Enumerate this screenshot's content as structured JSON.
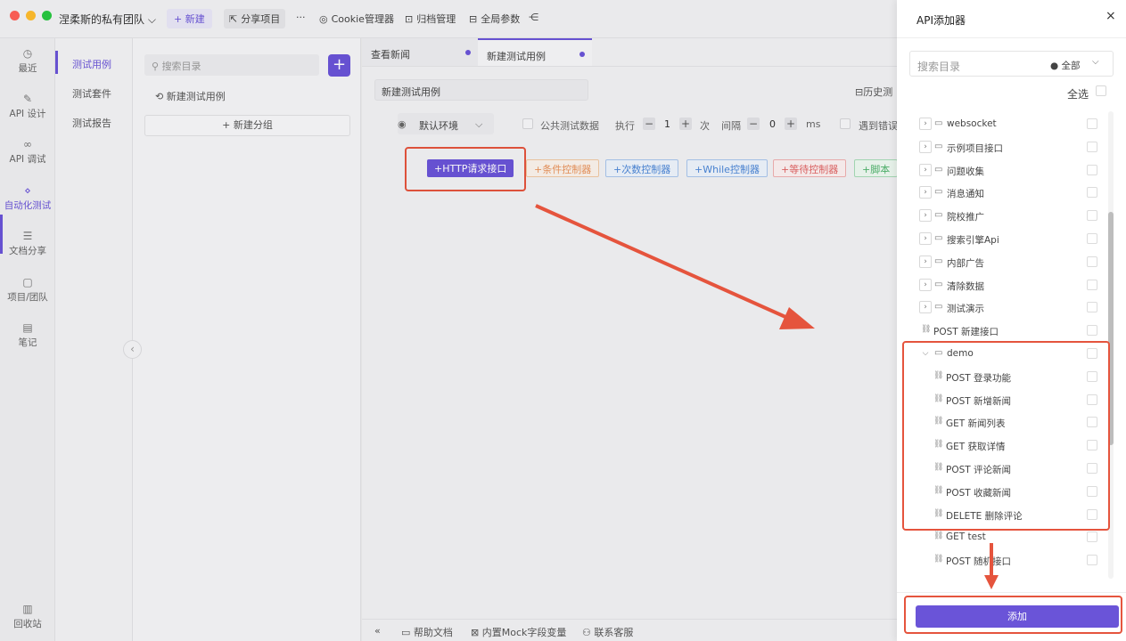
{
  "titlebar": {
    "team": "涅柔斯的私有团队",
    "new_label": "+ 新建",
    "share_label": "分享项目",
    "more": "···",
    "cookie_label": "Cookie管理器",
    "archive_label": "归档管理",
    "params_label": "全局参数"
  },
  "leftnav": {
    "items": [
      {
        "label": "最近",
        "icon": "clock-icon"
      },
      {
        "label": "API 设计",
        "icon": "edit-icon"
      },
      {
        "label": "API 调试",
        "icon": "link-icon"
      },
      {
        "label": "自动化测试",
        "icon": "flow-icon",
        "active": true
      },
      {
        "label": "文档分享",
        "icon": "doc-icon"
      },
      {
        "label": "项目/团队",
        "icon": "box-icon"
      },
      {
        "label": "笔记",
        "icon": "note-icon"
      }
    ],
    "trash": "回收站"
  },
  "subnav": {
    "items": [
      "测试用例",
      "测试套件",
      "测试报告"
    ]
  },
  "treecol": {
    "search_placeholder": "搜索目录",
    "plus": "+",
    "case_label": "新建测试用例",
    "new_group": "+ 新建分组",
    "collapse": "‹"
  },
  "main": {
    "tabs": [
      {
        "label": "查看新闻"
      },
      {
        "label": "新建测试用例"
      }
    ],
    "case_name": "新建测试用例",
    "history": "历史测",
    "config": {
      "env": "默认环境",
      "public_data": "公共测试数据",
      "exec": "执行",
      "exec_count": "1",
      "times_unit": "次",
      "interval": "间隔",
      "interval_value": "0",
      "ms": "ms",
      "on_error": "遇到错误",
      "minus": "−",
      "plus": "+"
    },
    "controls": {
      "http": "+HTTP请求接口",
      "condition": "+条件控制器",
      "count": "+次数控制器",
      "while": "+While控制器",
      "wait": "+等待控制器",
      "script": "+脚本"
    },
    "footer": {
      "collapse": "«",
      "help": "帮助文档",
      "mock": "内置Mock字段变量",
      "support": "联系客服"
    }
  },
  "drawer": {
    "title": "API添加器",
    "close": "×",
    "search_placeholder": "搜索目录",
    "scope": "● 全部",
    "select_all": "全选",
    "tree": [
      {
        "type": "folder",
        "label": "websocket",
        "depth": 0
      },
      {
        "type": "folder",
        "label": "示例项目接口",
        "depth": 0
      },
      {
        "type": "folder",
        "label": "问题收集",
        "depth": 0
      },
      {
        "type": "folder",
        "label": "消息通知",
        "depth": 0
      },
      {
        "type": "folder",
        "label": "院校推广",
        "depth": 0
      },
      {
        "type": "folder",
        "label": "搜索引擎Api",
        "depth": 0
      },
      {
        "type": "folder",
        "label": "内部广告",
        "depth": 0
      },
      {
        "type": "folder",
        "label": "清除数据",
        "depth": 0
      },
      {
        "type": "folder",
        "label": "测试演示",
        "depth": 0
      },
      {
        "type": "api",
        "label": "POST  新建接口",
        "depth": 0
      },
      {
        "type": "folder-open",
        "label": "demo",
        "depth": 0
      },
      {
        "type": "api",
        "label": "POST  登录功能",
        "depth": 1
      },
      {
        "type": "api",
        "label": "POST  新增新闻",
        "depth": 1
      },
      {
        "type": "api",
        "label": "GET  新闻列表",
        "depth": 1
      },
      {
        "type": "api",
        "label": "GET  获取详情",
        "depth": 1
      },
      {
        "type": "api",
        "label": "POST  评论新闻",
        "depth": 1
      },
      {
        "type": "api",
        "label": "POST  收藏新闻",
        "depth": 1
      },
      {
        "type": "api",
        "label": "DELETE  删除评论",
        "depth": 1
      },
      {
        "type": "api",
        "label": "GET  test",
        "depth": 1
      },
      {
        "type": "api",
        "label": "POST  随机接口",
        "depth": 1
      }
    ],
    "add_button": "添加"
  },
  "colors": {
    "accent": "#6a54d8",
    "annotation": "#e5543d"
  }
}
